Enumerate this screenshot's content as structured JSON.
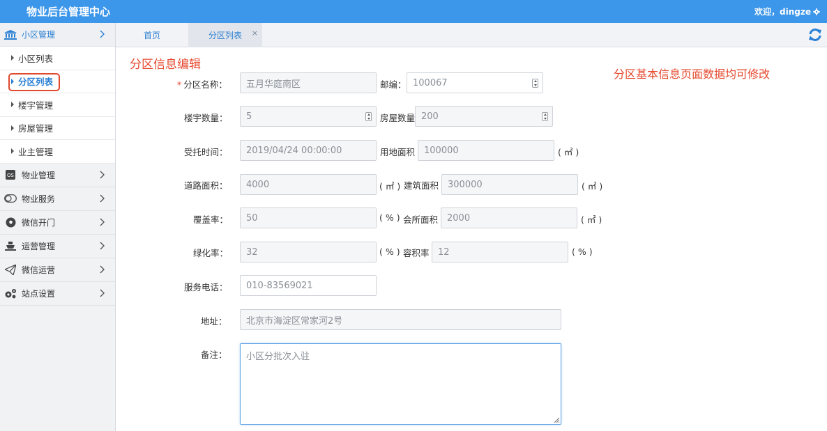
{
  "app": {
    "title": "物业后台管理中心",
    "welcome": "欢迎，dingze"
  },
  "sidebar": {
    "sections": [
      {
        "label": "小区管理",
        "icon": "bank-icon"
      },
      {
        "label": "物业管理",
        "icon": "os-badge-icon"
      },
      {
        "label": "物业服务",
        "icon": "toggle-icon"
      },
      {
        "label": "微信开门",
        "icon": "soccer-ball-icon"
      },
      {
        "label": "运营管理",
        "icon": "ship-icon"
      },
      {
        "label": "微信运营",
        "icon": "paper-plane-icon"
      },
      {
        "label": "站点设置",
        "icon": "cogs-icon"
      }
    ],
    "sub_items": [
      "小区列表",
      "分区列表",
      "楼宇管理",
      "房屋管理",
      "业主管理"
    ],
    "current_sub": "分区列表"
  },
  "tabs": {
    "home": "首页",
    "current": "分区列表",
    "close": "×"
  },
  "page": {
    "title": "分区信息编辑",
    "note": "分区基本信息页面数据均可修改"
  },
  "form": {
    "partition_name_label": "分区名称：",
    "partition_name": "五月华庭南区",
    "postcode_label": "邮编：",
    "postcode": "100067",
    "building_count_label": "楼宇数量：",
    "building_count": "5",
    "house_count_label": "房屋数量",
    "house_count": "200",
    "entrust_time_label": "受托时间：",
    "entrust_time": "2019/04/24 00:00:00",
    "land_area_label": "用地面积",
    "land_area": "100000",
    "land_area_unit": "( ㎡ )",
    "road_area_label": "道路面积：",
    "road_area": "4000",
    "road_area_unit": "( ㎡ )",
    "floor_area_label": "建筑面积",
    "floor_area": "300000",
    "floor_area_unit": "( ㎡ )",
    "coverage_label": "覆盖率：",
    "coverage": "50",
    "coverage_unit": "( % )",
    "club_area_label": "会所面积",
    "club_area": "2000",
    "club_area_unit": "( ㎡ )",
    "green_label": "绿化率：",
    "green": "32",
    "green_unit": "( % )",
    "plot_ratio_label": "容积率",
    "plot_ratio": "12",
    "plot_ratio_unit": "( % )",
    "phone_label": "服务电话：",
    "phone": "010-83569021",
    "address_label": "地址：",
    "address": "北京市海淀区常家河2号",
    "remark_label": "备注：",
    "remark": "小区分批次入驻"
  }
}
